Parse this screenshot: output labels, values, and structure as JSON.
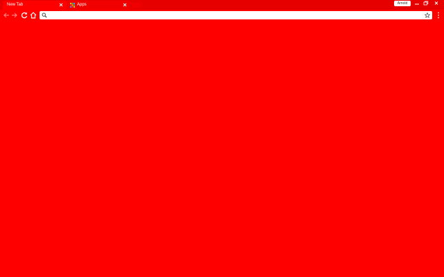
{
  "browser": {
    "tabs": [
      {
        "label": "New Tab",
        "active": true
      },
      {
        "label": "Apps",
        "active": false
      }
    ],
    "profile_name": "Arnold",
    "omnibox": {
      "value": "",
      "placeholder": ""
    },
    "theme_color": "#ff0000"
  },
  "icons": {
    "tab_close": "close-icon",
    "apps": "apps-grid-icon",
    "back": "back-arrow-icon",
    "forward": "forward-arrow-icon",
    "reload": "reload-icon",
    "home": "home-icon",
    "search": "search-icon",
    "bookmark": "star-icon",
    "menu": "kebab-menu-icon"
  }
}
